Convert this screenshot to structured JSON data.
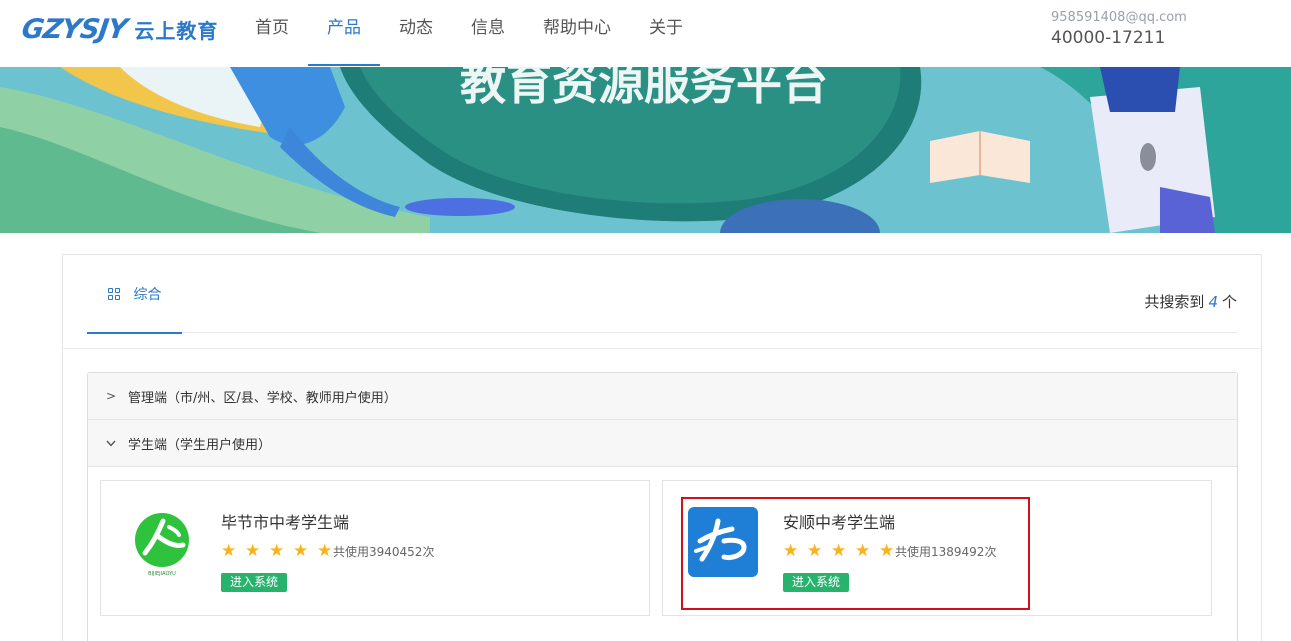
{
  "header": {
    "logo_mark": "GZYSJY",
    "logo_text": "云上教育",
    "nav": [
      {
        "label": "首页",
        "active": false
      },
      {
        "label": "产品",
        "active": true
      },
      {
        "label": "动态",
        "active": false
      },
      {
        "label": "信息",
        "active": false
      },
      {
        "label": "帮助中心",
        "active": false
      },
      {
        "label": "关于",
        "active": false
      }
    ],
    "email": "958591408@qq.com",
    "phone": "40000-17211"
  },
  "banner": {
    "headline": "教育资源服务平台"
  },
  "tabs": {
    "active_label": "综合",
    "active_icon": "grid-icon",
    "result_prefix": "共搜索到",
    "result_count": "4",
    "result_suffix": "个"
  },
  "sections": [
    {
      "label": "管理端（市/州、区/县、学校、教师用户使用）",
      "expanded": false,
      "icon": "chevron-right-icon"
    },
    {
      "label": "学生端（学生用户使用）",
      "expanded": true,
      "icon": "chevron-down-icon"
    }
  ],
  "products": [
    {
      "title": "毕节市中考学生端",
      "rating": 5,
      "usage": "共使用3940452次",
      "button": "进入系统",
      "logo_caption": "BIJIEJIAOYU"
    },
    {
      "title": "安顺中考学生端",
      "rating": 5,
      "usage": "共使用1389492次",
      "button": "进入系统"
    }
  ],
  "colors": {
    "accent": "#2b79c8",
    "button": "#27b36e",
    "star": "#f7b21c",
    "highlight": "#d0101b"
  }
}
